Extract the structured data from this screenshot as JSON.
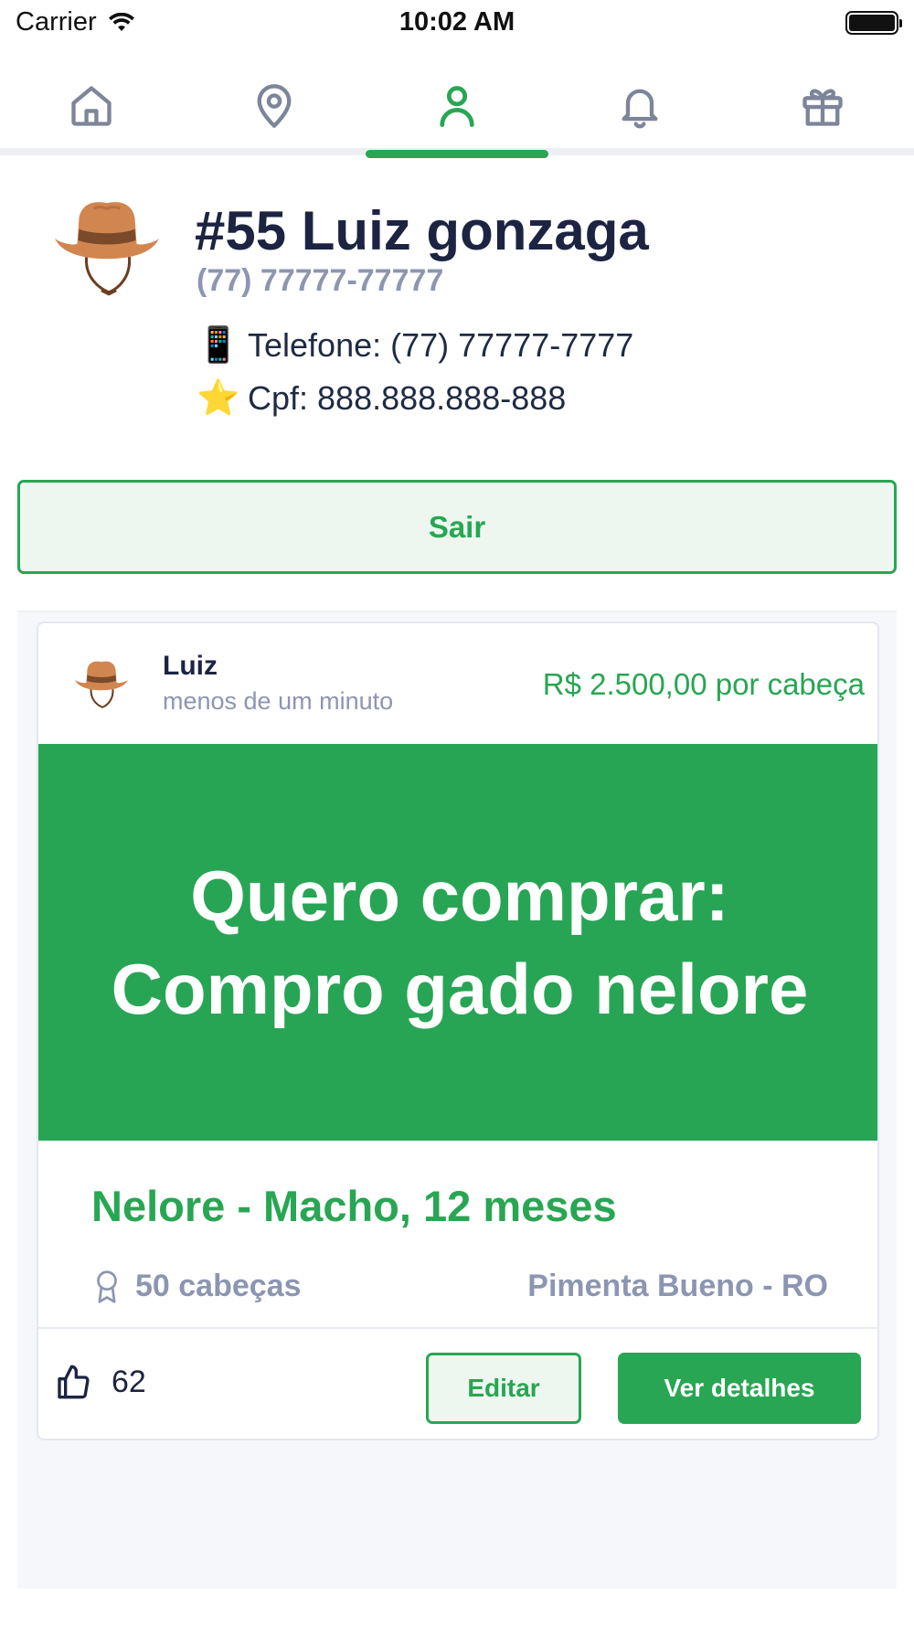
{
  "status_bar": {
    "carrier": "Carrier",
    "time": "10:02 AM"
  },
  "tabs": [
    {
      "icon": "home-icon",
      "active": false
    },
    {
      "icon": "location-pin-icon",
      "active": false
    },
    {
      "icon": "user-icon",
      "active": true
    },
    {
      "icon": "bell-icon",
      "active": false
    },
    {
      "icon": "gift-icon",
      "active": false
    }
  ],
  "colors": {
    "accent": "#28a653",
    "tab_inactive": "#7d8599",
    "muted_text": "#8c96b1",
    "dark_text": "#1c2442"
  },
  "profile": {
    "avatar_icon": "cowboy-hat-icon",
    "title": "#55 Luiz gonzaga",
    "subtitle": "(77) 77777-77777",
    "phone_emoji": "📱",
    "phone": "Telefone: (77) 77777-7777",
    "cpf_emoji": "⭐",
    "cpf": "Cpf: 888.888.888-888"
  },
  "logout_label": "Sair",
  "post": {
    "avatar_icon": "cowboy-hat-icon",
    "user": "Luiz",
    "time_ago": "menos de um minuto",
    "price": "R$ 2.500,00 por cabeça",
    "banner_line1": "Quero comprar:",
    "banner_line2": "Compro gado nelore",
    "breed": "Nelore - Macho, 12 meses",
    "quantity_icon": "award-icon",
    "quantity": "50 cabeças",
    "location": "Pimenta Bueno - RO",
    "like_icon": "thumbs-up-icon",
    "likes": "62",
    "edit_label": "Editar",
    "details_label": "Ver detalhes"
  }
}
